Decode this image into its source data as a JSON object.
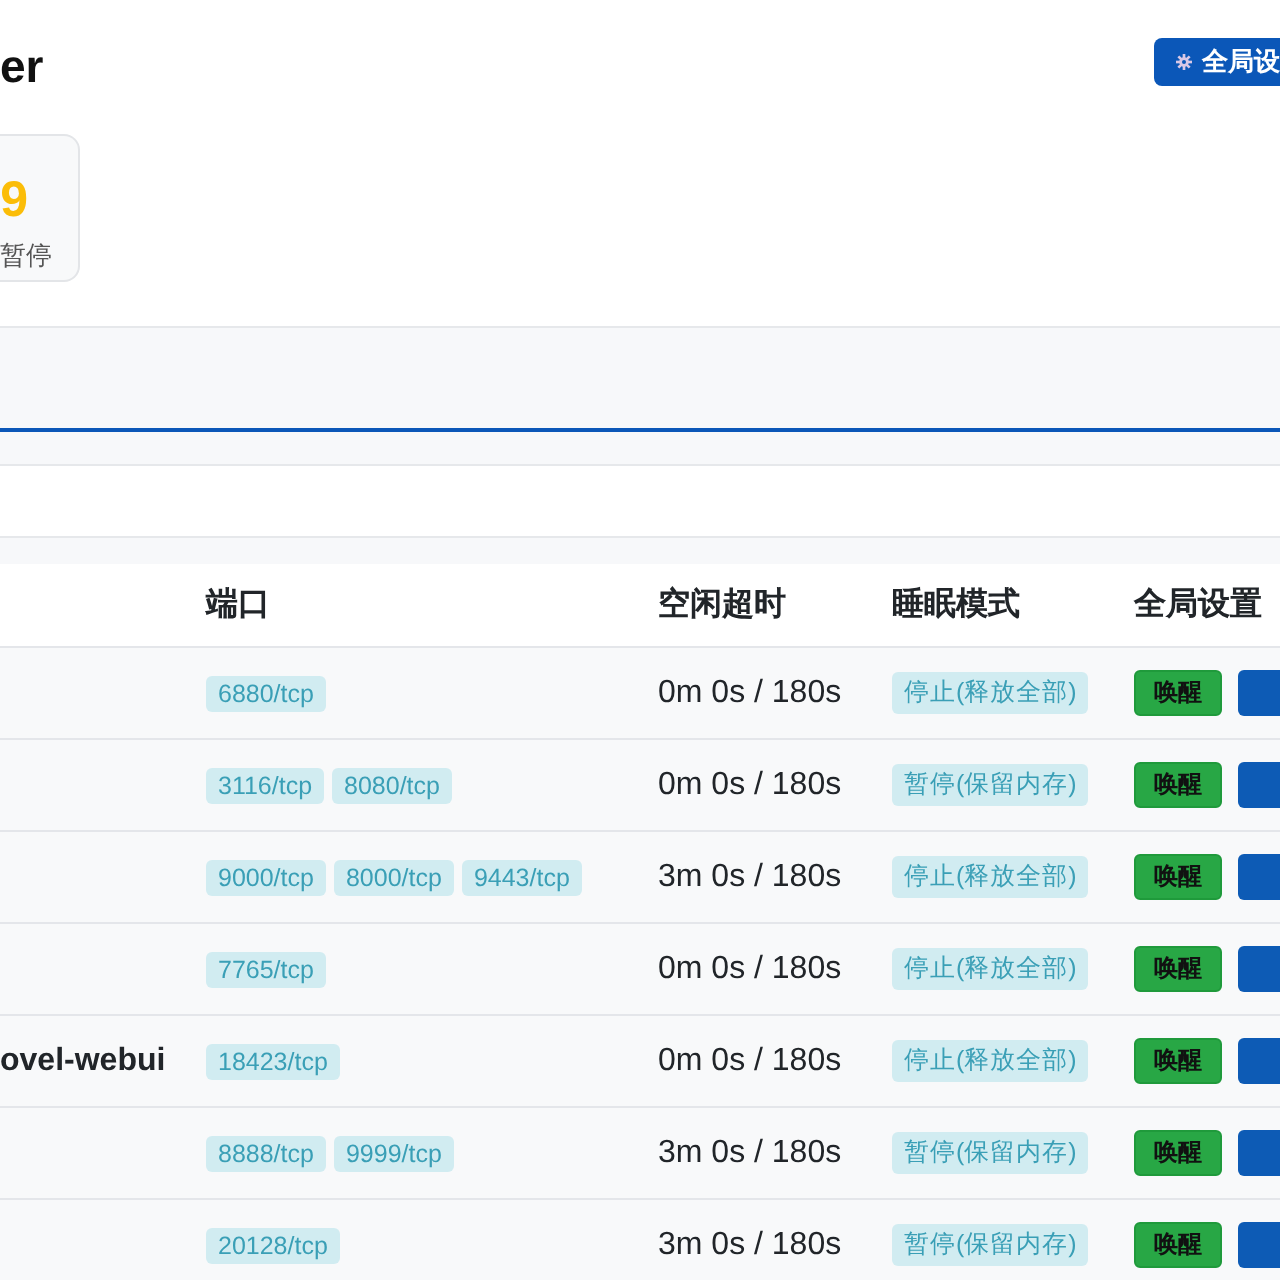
{
  "header": {
    "title": "er",
    "settings_button": "全局设"
  },
  "stats": [
    {
      "value": "9",
      "label": "暂停"
    }
  ],
  "table": {
    "columns": [
      "端口",
      "空闲超时",
      "睡眠模式",
      "全局设置"
    ],
    "rows": [
      {
        "ports": [
          "6880/tcp"
        ],
        "idle": "0m 0s / 180s",
        "mode": "停止(释放全部)",
        "wake": "唤醒"
      },
      {
        "ports": [
          "3116/tcp",
          "8080/tcp"
        ],
        "idle": "0m 0s / 180s",
        "mode": "暂停(保留内存)",
        "wake": "唤醒"
      },
      {
        "ports": [
          "9000/tcp",
          "8000/tcp",
          "9443/tcp"
        ],
        "idle": "3m 0s / 180s",
        "mode": "停止(释放全部)",
        "wake": "唤醒"
      },
      {
        "ports": [
          "7765/tcp"
        ],
        "idle": "0m 0s / 180s",
        "mode": "停止(释放全部)",
        "wake": "唤醒"
      },
      {
        "name": "ovel-webui",
        "ports": [
          "18423/tcp"
        ],
        "idle": "0m 0s / 180s",
        "mode": "停止(释放全部)",
        "wake": "唤醒"
      },
      {
        "ports": [
          "8888/tcp",
          "9999/tcp"
        ],
        "idle": "3m 0s / 180s",
        "mode": "暂停(保留内存)",
        "wake": "唤醒"
      },
      {
        "ports": [
          "20128/tcp"
        ],
        "idle": "3m 0s / 180s",
        "mode": "暂停(保留内存)",
        "wake": "唤醒"
      }
    ]
  }
}
